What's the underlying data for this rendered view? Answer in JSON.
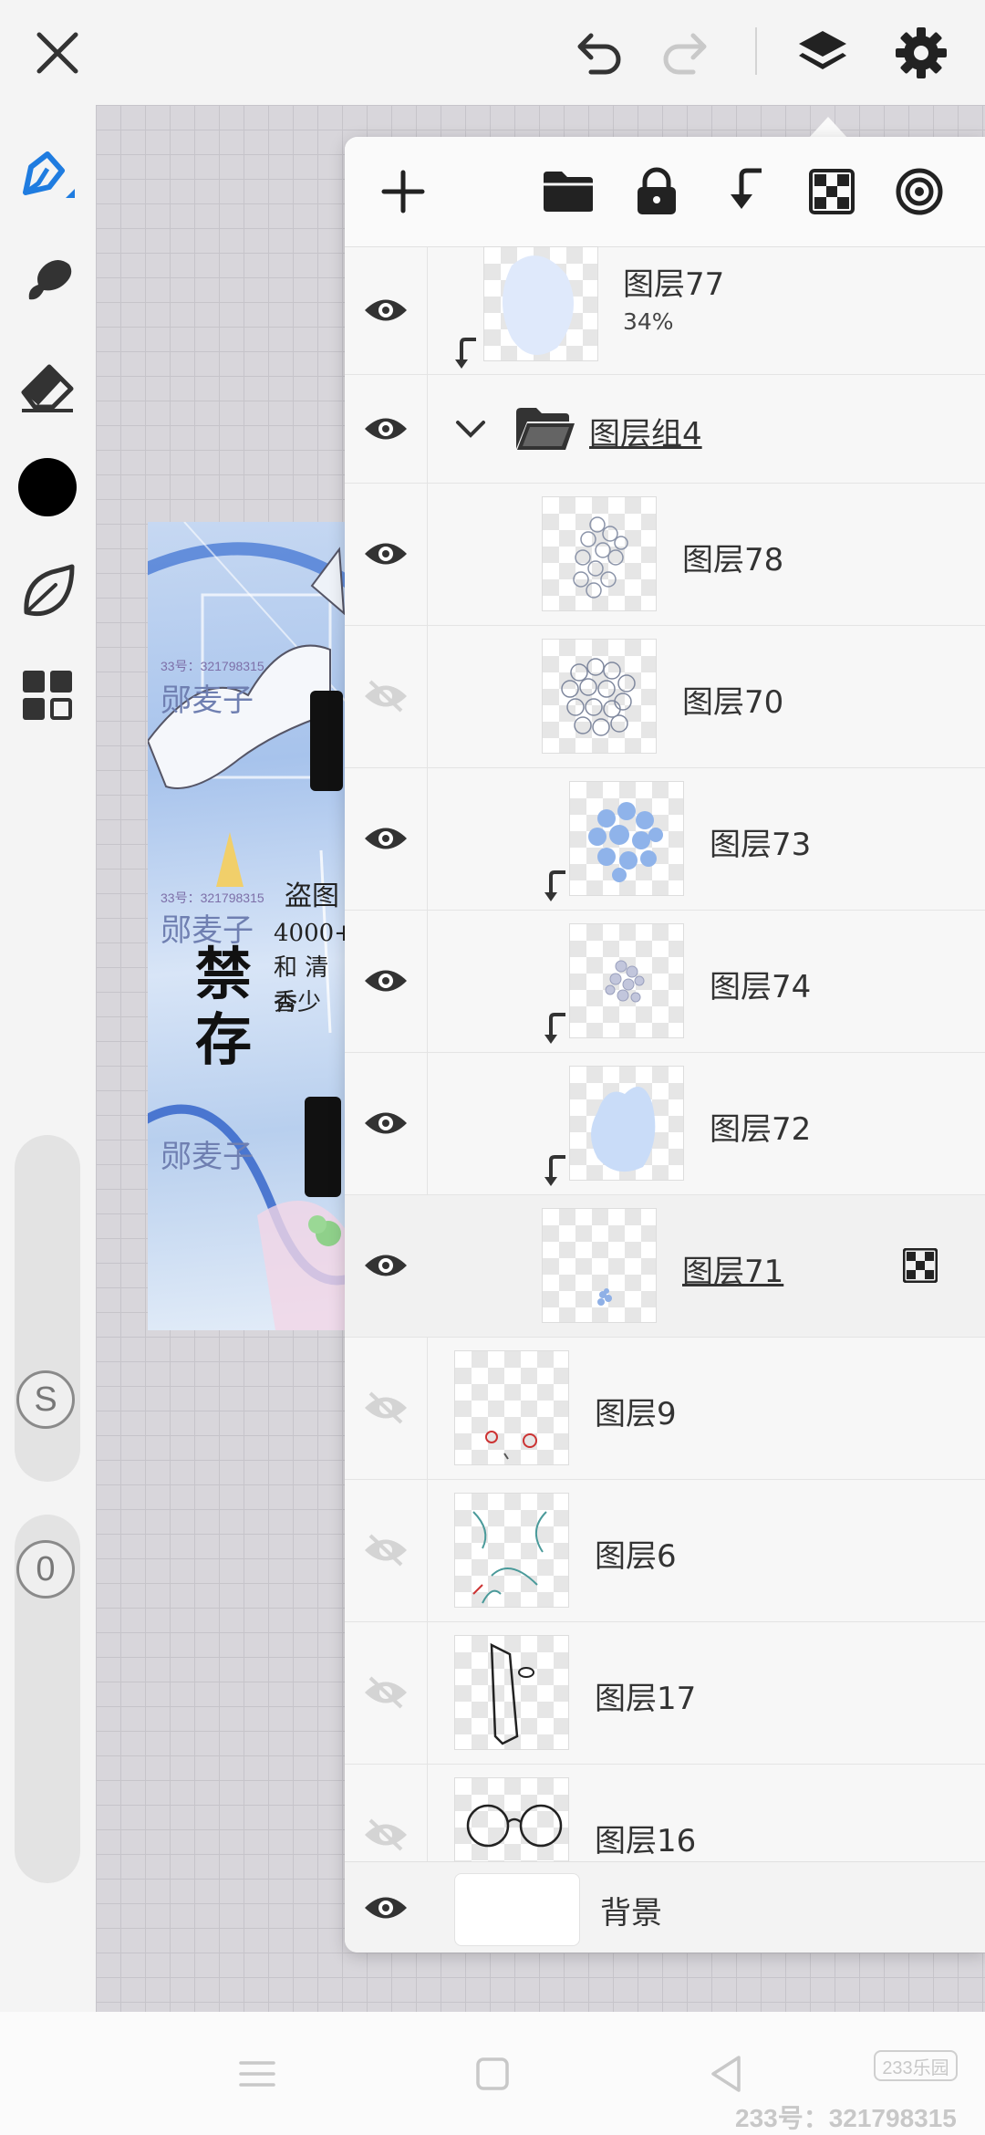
{
  "top_bar": {
    "icons": [
      "close-icon",
      "undo-icon",
      "redo-icon",
      "layers-icon",
      "settings-icon"
    ]
  },
  "left_toolbar": {
    "tools": [
      "pen-icon",
      "smudge-brush-icon",
      "eraser-icon",
      "color-swatch",
      "leaf-brush-icon",
      "materials-grid-icon"
    ],
    "current_color": "#000000",
    "size_slider_label": "S",
    "opacity_slider_label": "0"
  },
  "artwork": {
    "watermark_id_1": "33号：321798315",
    "watermark_id_2": "33号：321798315",
    "watermark_name_1": "郧麦子",
    "watermark_name_2": "郧麦子",
    "watermark_name_3": "郧麦子",
    "big_text": "禁存",
    "scribble_lines": [
      "盗图",
      "4000+",
      "和 清香少",
      "秀"
    ]
  },
  "layers_panel": {
    "toolbar_icons": [
      "add-layer-icon",
      "folder-icon",
      "lock-icon",
      "clip-mask-icon",
      "alpha-lock-icon",
      "layer-target-icon"
    ],
    "layers": [
      {
        "name": "图层77",
        "opacity": "34%",
        "visible": true,
        "clipped": true
      },
      {
        "name": "图层组4",
        "type": "group",
        "visible": true,
        "expanded": true
      },
      {
        "name": "图层78",
        "visible": true
      },
      {
        "name": "图层70",
        "visible": false
      },
      {
        "name": "图层73",
        "visible": true,
        "clipped": true
      },
      {
        "name": "图层74",
        "visible": true,
        "clipped": true
      },
      {
        "name": "图层72",
        "visible": true,
        "clipped": true
      },
      {
        "name": "图层71",
        "visible": true,
        "selected": true,
        "alpha_locked": true
      },
      {
        "name": "图层9",
        "visible": false
      },
      {
        "name": "图层6",
        "visible": false
      },
      {
        "name": "图层17",
        "visible": false
      },
      {
        "name": "图层16",
        "visible": false
      }
    ],
    "background_layer": {
      "name": "背景",
      "visible": true
    }
  },
  "nav_bar": {
    "icons": [
      "menu-icon",
      "home-icon",
      "back-icon"
    ],
    "badge": "233乐园",
    "watermark": "233号：321798315"
  },
  "colors": {
    "accent": "#1f7ce0",
    "panel_bg": "#f7f7f7"
  }
}
